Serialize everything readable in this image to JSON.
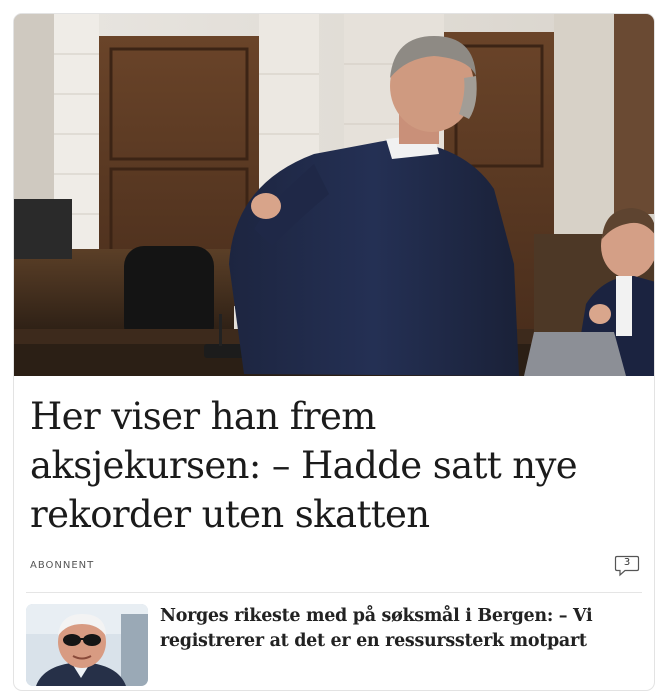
{
  "main_article": {
    "headline": "Her viser han frem aksjekursen: – Hadde satt nye rekorder uten skatten",
    "tag": "ABONNENT",
    "comment_count": "3",
    "image_alt": "Man in a dark suit holding a paper in a courtroom"
  },
  "related_article": {
    "title": "Norges rikeste med på søksmål i Bergen: – Vi registrerer at det er en ressurssterk motpart",
    "image_alt": "Older man with sunglasses"
  },
  "colors": {
    "headline": "#1b1b1b",
    "tag": "#555555",
    "border": "#e3e3e3"
  }
}
